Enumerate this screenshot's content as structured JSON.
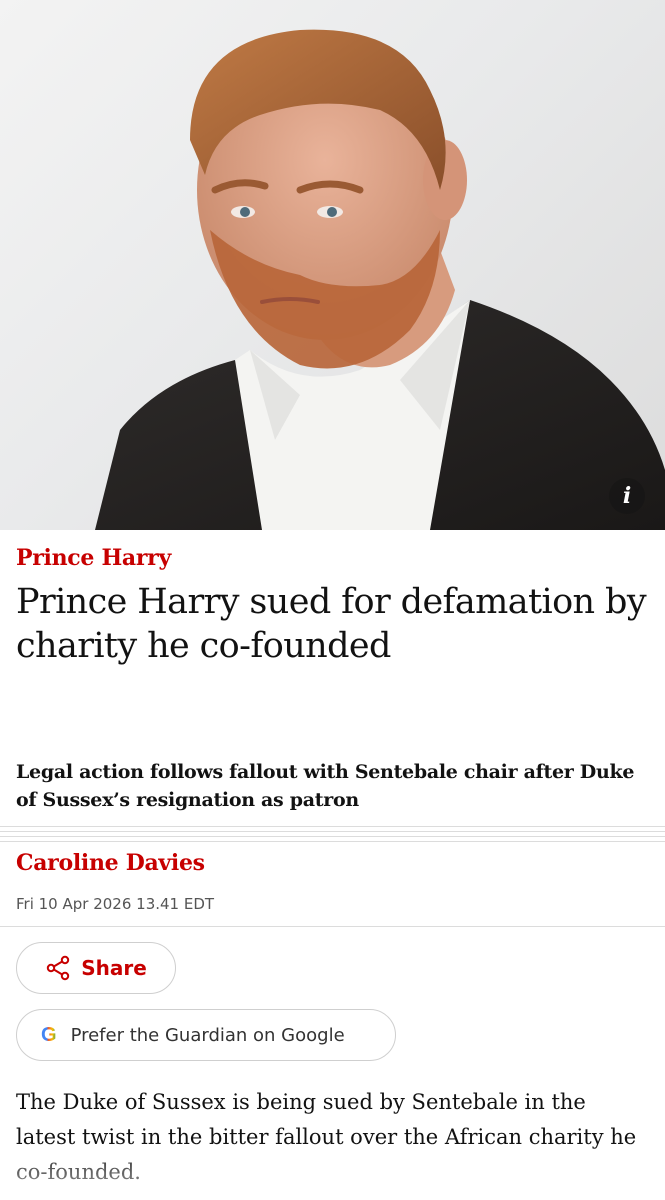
{
  "hero": {
    "image_description_icon": "portrait-photo",
    "info_label": "i"
  },
  "article": {
    "kicker": "Prince Harry",
    "headline": "Prince Harry sued for defamation by charity he co-founded",
    "standfirst": "Legal action follows fallout with Sentebale chair after Duke of Sussex’s resignation as patron",
    "byline": "Caroline Davies",
    "dateline": "Fri 10 Apr 2026 13.41 EDT",
    "body": "The Duke of Sussex is being sued by Sentebale in the latest twist in the bitter fallout over the African charity he co-founded."
  },
  "actions": {
    "share_label": "Share",
    "google_label": "Prefer the Guardian on Google",
    "google_icon": "G"
  },
  "colors": {
    "accent": "#c70000",
    "text": "#121212"
  }
}
